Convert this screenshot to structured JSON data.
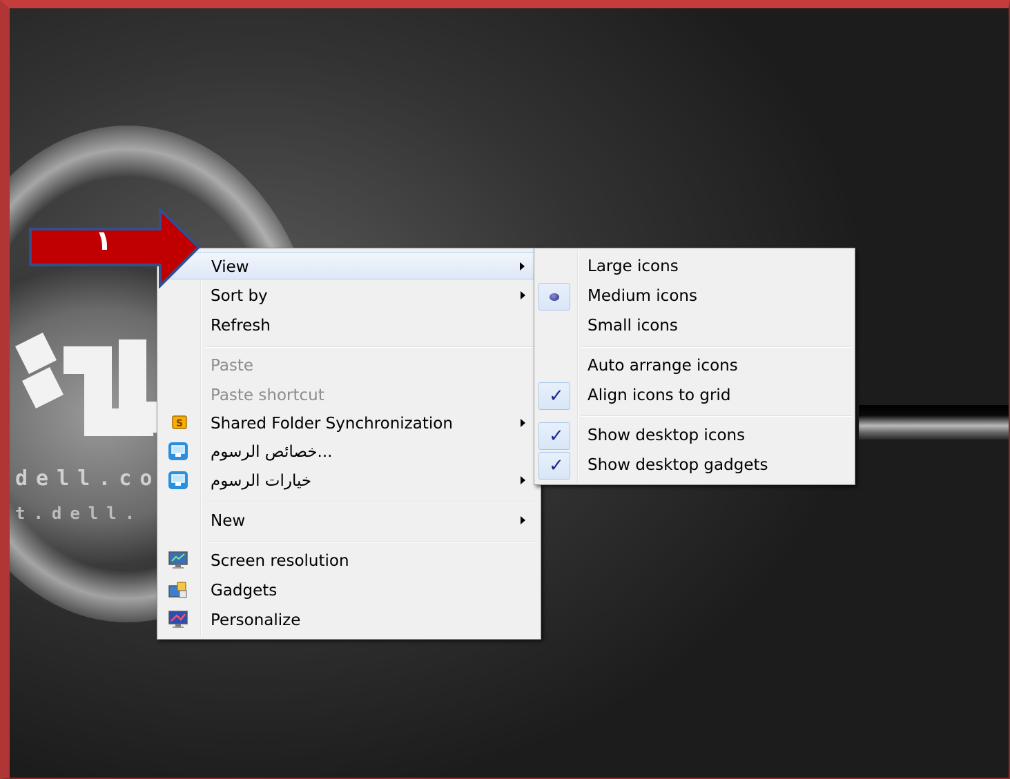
{
  "callout": {
    "number": "١"
  },
  "desktop": {
    "url_line1": "dell.co",
    "url_line2": "t.dell."
  },
  "main_menu": {
    "items": [
      {
        "label": "View",
        "submenu": true,
        "highlighted": true
      },
      {
        "label": "Sort by",
        "submenu": true
      },
      {
        "label": "Refresh"
      },
      {
        "label": "Paste",
        "disabled": true
      },
      {
        "label": "Paste shortcut",
        "disabled": true
      },
      {
        "label": "Shared Folder Synchronization",
        "submenu": true,
        "icon": "sync-folder-icon"
      },
      {
        "label": "خصائص الرسوم...",
        "icon": "graphics-properties-icon"
      },
      {
        "label": "خيارات الرسوم",
        "submenu": true,
        "icon": "graphics-options-icon"
      },
      {
        "label": "New",
        "submenu": true
      },
      {
        "label": "Screen resolution",
        "icon": "screen-resolution-icon"
      },
      {
        "label": "Gadgets",
        "icon": "gadgets-icon"
      },
      {
        "label": "Personalize",
        "icon": "personalize-icon"
      }
    ]
  },
  "view_submenu": {
    "items": [
      {
        "label": "Large icons"
      },
      {
        "label": "Medium icons",
        "mark": "radio"
      },
      {
        "label": "Small icons"
      },
      {
        "label": "Auto arrange icons"
      },
      {
        "label": "Align icons to grid",
        "mark": "check"
      },
      {
        "label": "Show desktop icons",
        "mark": "check"
      },
      {
        "label": "Show desktop gadgets",
        "mark": "check"
      }
    ]
  },
  "colors": {
    "frame_border": "#c43c3c",
    "menu_bg": "#f0f0f0",
    "highlight_border": "#aecff7",
    "callout_arrow": "#c00000",
    "callout_outline": "#2f4f8f"
  }
}
